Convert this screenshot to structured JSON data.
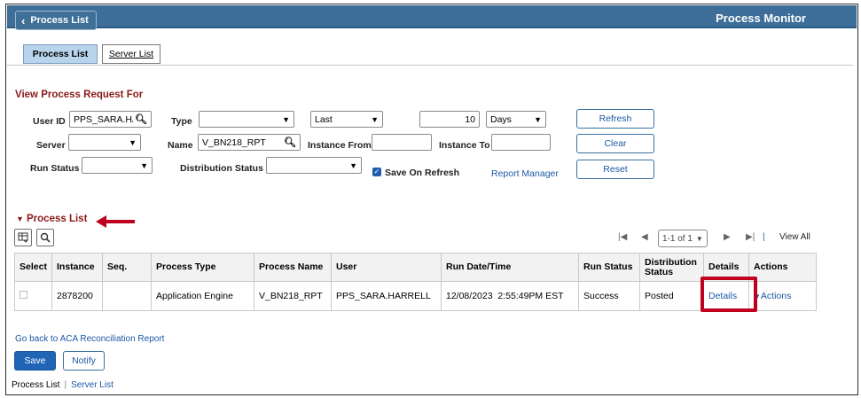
{
  "header": {
    "back_label": "Process List",
    "title": "Process Monitor"
  },
  "tabs": [
    {
      "label": "Process List",
      "active": true
    },
    {
      "label": "Server List",
      "active": false,
      "underline_char": "S"
    }
  ],
  "filters": {
    "section_title": "View Process Request For",
    "user_id_label": "User ID",
    "user_id_value": "PPS_SARA.HA",
    "type_label": "Type",
    "type_value": "",
    "last_value": "Last",
    "last_count": "10",
    "days_value": "Days",
    "server_label": "Server",
    "server_value": "",
    "name_label": "Name",
    "name_value": "V_BN218_RPT",
    "instance_from_label": "Instance From",
    "instance_from_value": "",
    "instance_to_label": "Instance To",
    "instance_to_value": "",
    "run_status_label": "Run Status",
    "run_status_value": "",
    "dist_status_label": "Distribution Status",
    "dist_status_value": "",
    "save_on_refresh_label": "Save On Refresh",
    "save_on_refresh_checked": true,
    "report_manager_label": "Report Manager",
    "refresh_label": "Refresh",
    "clear_label": "Clear",
    "reset_label": "Reset"
  },
  "process_list": {
    "section_title": "Process List",
    "pager": {
      "first": "|◀",
      "prev": "◀",
      "range": "1-1 of 1",
      "next": "▶",
      "last": "▶|",
      "view_all": "View All"
    },
    "columns": [
      "Select",
      "Instance",
      "Seq.",
      "Process Type",
      "Process Name",
      "User",
      "Run Date/Time",
      "Run Status",
      "Distribution Status",
      "Details",
      "Actions"
    ],
    "rows": [
      {
        "select": false,
        "instance": "2878200",
        "seq": "",
        "process_type": "Application Engine",
        "process_name": "V_BN218_RPT",
        "user": "PPS_SARA.HARRELL",
        "run_datetime": "12/08/2023  2:55:49PM EST",
        "run_status": "Success",
        "distribution_status": "Posted",
        "details": "Details",
        "actions": "Actions"
      }
    ]
  },
  "footer": {
    "back_link": "Go back to ACA Reconciliation Report",
    "save_label": "Save",
    "notify_label": "Notify",
    "nav": [
      "Process List",
      "Server List"
    ]
  },
  "colors": {
    "header_bg": "#3d6e99",
    "section_title": "#8b1a1a",
    "link": "#1d58a5",
    "primary_button": "#1f64b5",
    "annotation_red": "#c0001e"
  }
}
